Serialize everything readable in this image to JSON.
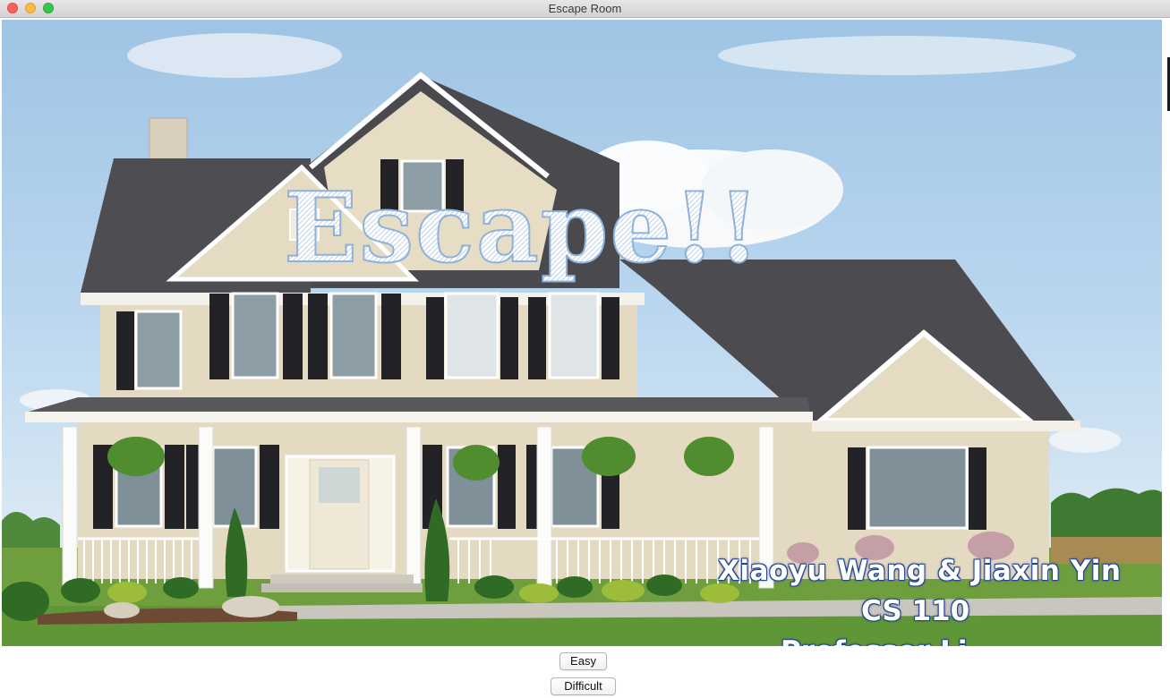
{
  "window": {
    "title": "Escape Room"
  },
  "game": {
    "title": "Escape!!",
    "authors": "Xiaoyu Wang & Jiaxin Yin",
    "course": "CS 110",
    "cut_line": "Professor Li"
  },
  "buttons": {
    "easy": "Easy",
    "difficult": "Difficult"
  }
}
